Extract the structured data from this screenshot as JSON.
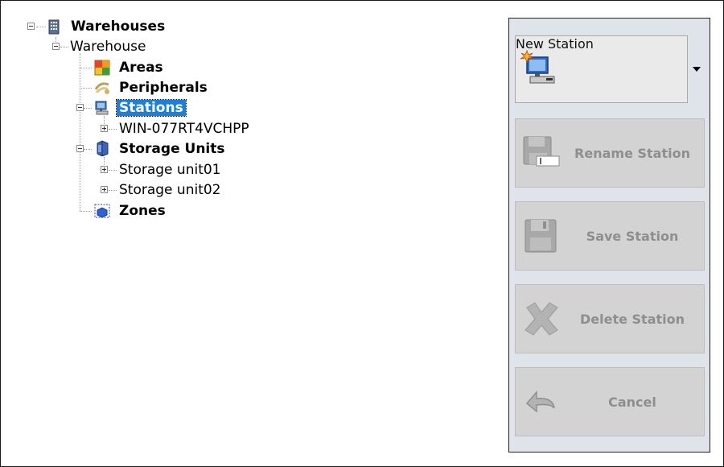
{
  "tree": {
    "root": {
      "label": "Warehouses"
    },
    "warehouse": {
      "label": "Warehouse"
    },
    "areas": {
      "label": "Areas"
    },
    "peripherals": {
      "label": "Peripherals"
    },
    "stations": {
      "label": "Stations",
      "selected": true
    },
    "station_item": {
      "label": "WIN-077RT4VCHPP"
    },
    "storage_units": {
      "label": "Storage Units"
    },
    "storage_unit_1": {
      "label": "Storage unit01"
    },
    "storage_unit_2": {
      "label": "Storage unit02"
    },
    "zones": {
      "label": "Zones"
    }
  },
  "actions": {
    "new_station": {
      "label": "New Station",
      "enabled": true,
      "icon": "new-station-icon"
    },
    "rename_station": {
      "label": "Rename Station",
      "enabled": false,
      "icon": "rename-icon"
    },
    "save_station": {
      "label": "Save Station",
      "enabled": false,
      "icon": "floppy-icon"
    },
    "delete_station": {
      "label": "Delete Station",
      "enabled": false,
      "icon": "delete-x-icon"
    },
    "cancel": {
      "label": "Cancel",
      "enabled": false,
      "icon": "undo-arrow-icon"
    }
  },
  "colors": {
    "selection": "#1e7fd6",
    "disabled_text": "#8e8e8e",
    "panel_bg": "#dfe3ea"
  }
}
